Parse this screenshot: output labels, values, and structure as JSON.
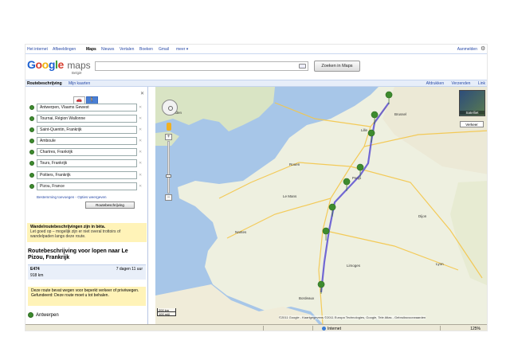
{
  "gbar": {
    "links": [
      "Het internet",
      "Afbeeldingen",
      "Maps",
      "Nieuws",
      "Vertalen",
      "Boeken",
      "Gmail",
      "meer ▾"
    ],
    "active": "Maps",
    "signin": "Aanmelden"
  },
  "header": {
    "logo_google": "Google",
    "logo_maps": "maps",
    "logo_sub": "België",
    "search_value": "",
    "search_button": "Zoeken in Maps"
  },
  "strip": {
    "title": "Routebeschrijving",
    "mymaps": "Mijn kaarten",
    "print": "Afdrukken",
    "send": "Verzenden",
    "link": "Link"
  },
  "waypoints": [
    "Antwerpen, Vlaams Gewest",
    "Tournai, Région Wallonne",
    "Saint-Quentin, Frankrijk",
    "Amboule",
    "Chartres, Frankrijk",
    "Tours, Frankrijk",
    "Poitiers, Frankrijk",
    "Pizou, France"
  ],
  "addlinks": "Bestemming toevoegen - Opties weergeven",
  "route_button": "Routebeschrijving",
  "warning1": {
    "title": "Wandelroutebeschrijvingen zijn in bèta.",
    "body": "Let goed op – mogelijk zijn er niet overal trottoirs of wandelpaden langs deze route."
  },
  "route_title": "Routebeschrijving voor lopen naar Le Pizou, Frankrijk",
  "summary": {
    "road": "E474",
    "duration": "7 dagen 11 uur",
    "distance": "918 km"
  },
  "warning2": "Deze route bevat wegen voor beperkt verkeer of privéwegen. Gefundeerd: Deze route moet u tot behalen.",
  "start_label": "Antwerpen",
  "map": {
    "satellite": "Satelliet",
    "traffic": "Verkeer",
    "scale_top": "200 km",
    "scale_bottom": "100 mijl",
    "copyright": "©2011 Google - Kaartgegevens ©2011 Europa Technologies, Google, Tele Atlas - Gebruiksvoorwaarden",
    "labels": [
      "Londen",
      "Parijs",
      "Nantes",
      "Bordeaux",
      "Brussel",
      "Lille",
      "Rouen",
      "Le Mans",
      "Dijon",
      "Lyon",
      "Limoges"
    ]
  },
  "statusbar": {
    "zone": "Internet",
    "zoom": "125%"
  }
}
